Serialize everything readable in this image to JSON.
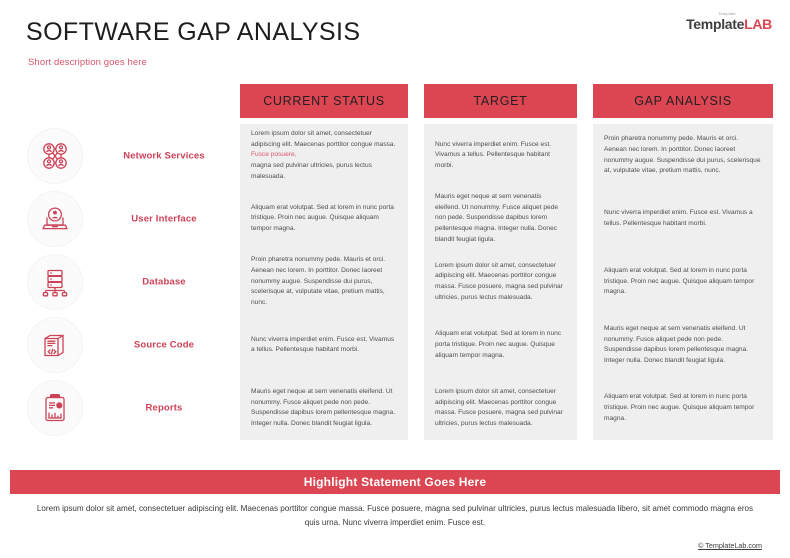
{
  "header": {
    "title": "SOFTWARE GAP ANALYSIS",
    "subtitle": "Short description goes here",
    "brand": {
      "superscript": "Template",
      "name_dark": "Template",
      "name_accent": "LAB"
    }
  },
  "colors": {
    "accent_red": "#dc4552",
    "label_red": "#cc4257",
    "cell_bg": "#efefef",
    "page_bg": "#ffffff",
    "body_text": "#4e4e4e"
  },
  "matrix": {
    "columns": [
      {
        "label": "CURRENT STATUS",
        "key": "current_status"
      },
      {
        "label": "TARGET",
        "key": "target"
      },
      {
        "label": "GAP ANALYSIS",
        "key": "gap_analysis"
      }
    ],
    "rows": [
      {
        "label": "Network Services",
        "icon": "network-users-icon",
        "current_status_pre": "Lorem ipsum dolor sit amet, consectetuer adipiscing elit. Maecenas porttitor congue massa. ",
        "current_status_highlight": "Fusce posuere,",
        "current_status_post": " magna sed pulvinar ultricies, purus lectus malesuada.",
        "target": "Nunc viverra imperdiet enim. Fusce est. Vivamus a tellus. Pellentesque habitant morbi.",
        "gap_analysis": "Proin pharetra nonummy pede. Mauris et orci. Aenean nec lorem. In porttitor. Donec laoreet nonummy augue. Suspendisse dui purus, scelerisque at, vulputate vitae, pretium mattis, nunc."
      },
      {
        "label": "User Interface",
        "icon": "user-laptop-icon",
        "current_status": "Aliquam erat volutpat. Sed at lorem in nunc porta tristique. Proin nec augue. Quisque aliquam tempor magna.",
        "target": "Mauris eget neque at sem venenatis eleifend. Ut nonummy. Fusce aliquet pede non pede. Suspendisse dapibus lorem pellentesque magna. Integer nulla. Donec blandit feugiat ligula.",
        "gap_analysis": "Nunc viverra imperdiet enim. Fusce est. Vivamus a tellus. Pellentesque habitant morbi."
      },
      {
        "label": "Database",
        "icon": "database-server-icon",
        "current_status": "Proin pharetra nonummy pede. Mauris et orci. Aenean nec lorem. In porttitor. Donec laoreet nonummy augue. Suspendisse dui purus, scelerisque at, vulputate vitae, pretium mattis, nunc.",
        "target": "Lorem ipsum dolor sit amet, consectetuer adipiscing elit. Maecenas porttitor congue massa. Fusce posuere, magna sed pulvinar ultricies, purus lectus malesuada.",
        "gap_analysis": "Aliquam erat volutpat. Sed at lorem in nunc porta tristique. Proin nec augue. Quisque aliquam tempor magna."
      },
      {
        "label": "Source Code",
        "icon": "code-document-icon",
        "current_status": "Nunc viverra imperdiet enim. Fusce est. Vivamus a tellus. Pellentesque habitant morbi.",
        "target": "Aliquam erat volutpat. Sed at lorem in nunc porta tristique. Proin nec augue. Quisque aliquam tempor magna.",
        "gap_analysis": "Mauris eget neque at sem venenatis eleifend. Ut nonummy. Fusce aliquet pede non pede. Suspendisse dapibus lorem pellentesque magna. Integer nulla. Donec blandit feugiat ligula."
      },
      {
        "label": "Reports",
        "icon": "clipboard-report-icon",
        "current_status": "Mauris eget neque at sem venenatis eleifend. Ut nonummy. Fusce aliquet pede non pede. Suspendisse dapibus lorem pellentesque magna. Integer nulla. Donec blandit feugiat ligula.",
        "target": "Lorem ipsum dolor sit amet, consectetuer adipiscing elit. Maecenas porttitor congue massa. Fusce posuere, magna sed pulvinar ultricies, purus lectus malesuada.",
        "gap_analysis": "Aliquam erat volutpat. Sed at lorem in nunc porta tristique. Proin nec augue. Quisque aliquam tempor magna."
      }
    ]
  },
  "footer": {
    "highlight": "Highlight Statement Goes Here",
    "body": "Lorem ipsum dolor sit amet, consectetuer adipiscing elit. Maecenas porttitor congue massa. Fusce posuere, magna sed pulvinar ultricies, purus lectus malesuada libero, sit amet commodo magna eros quis urna. Nunc viverra imperdiet enim. Fusce est.",
    "copyright": "© TemplateLab.com"
  }
}
